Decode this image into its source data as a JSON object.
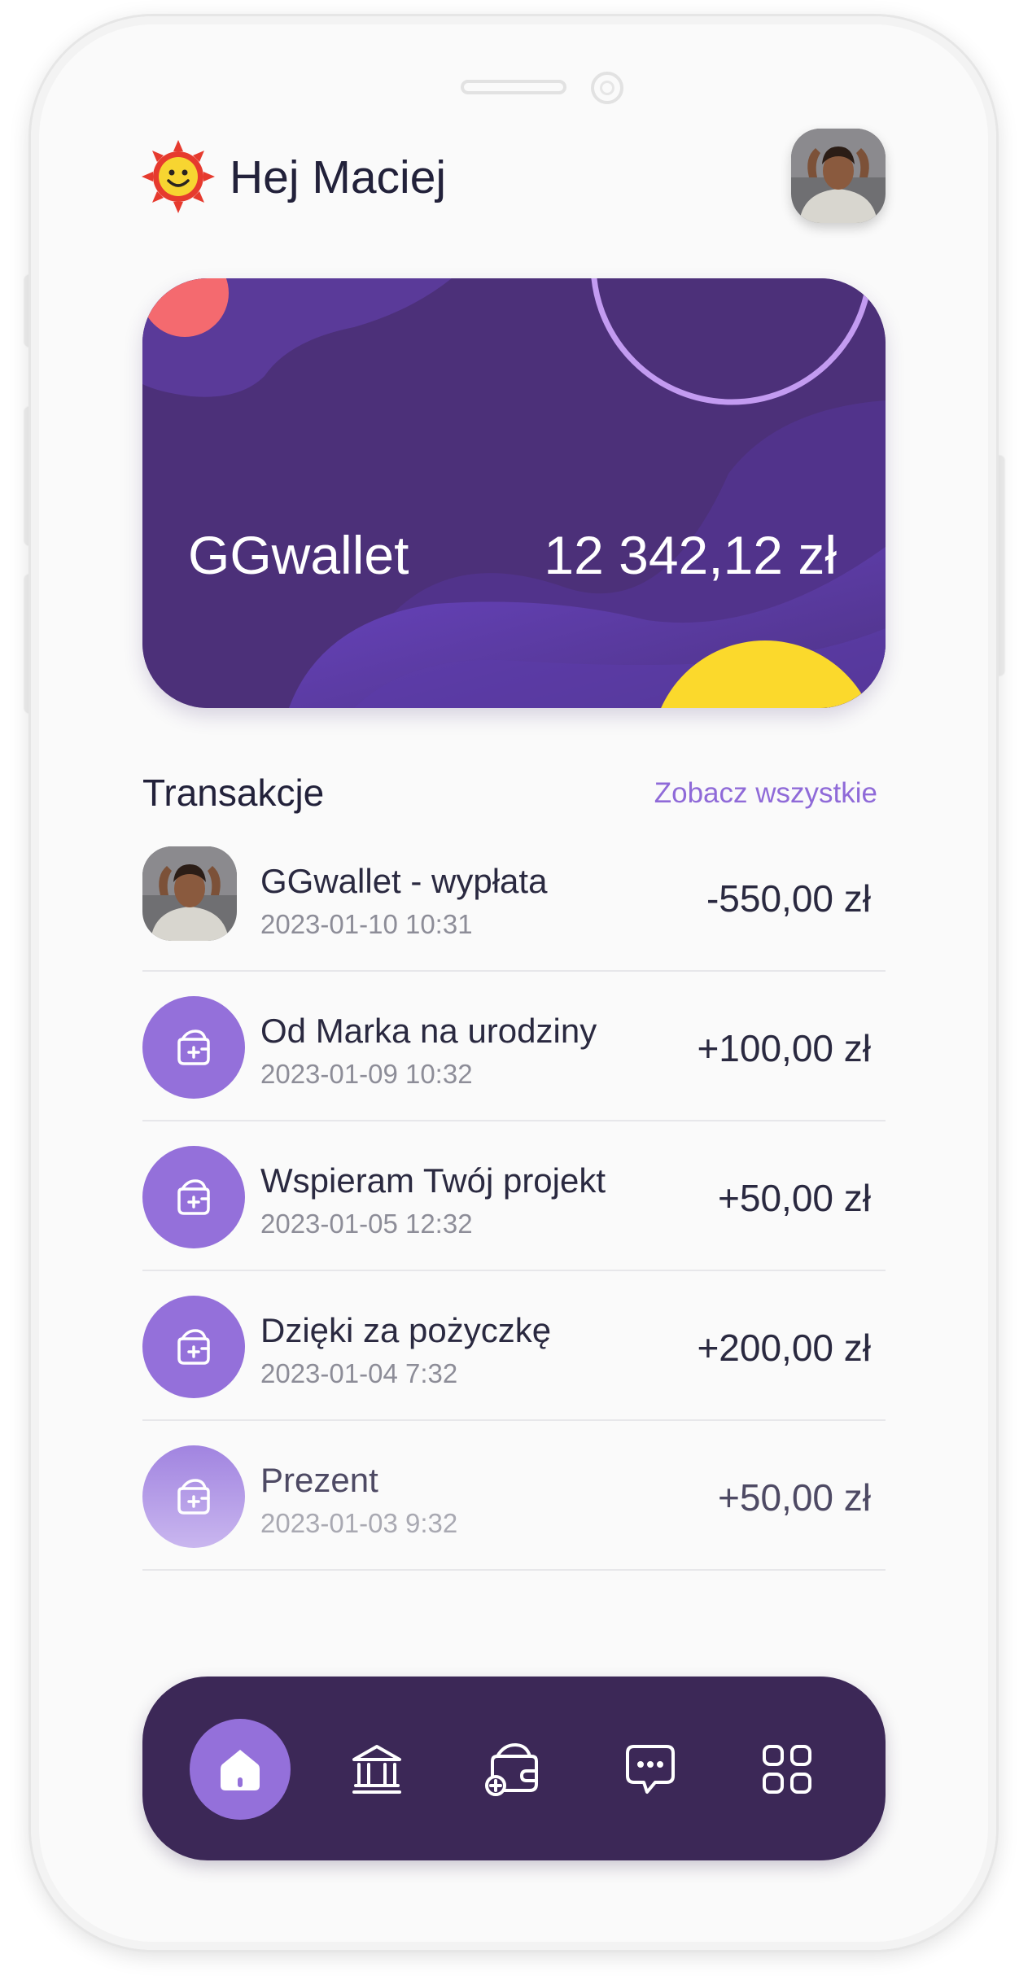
{
  "header": {
    "greeting": "Hej Maciej",
    "greeting_icon": "sun-smiley-icon",
    "avatar": "user-avatar"
  },
  "card": {
    "name": "GGwallet",
    "balance": "12 342,12 zł"
  },
  "transactions": {
    "title": "Transakcje",
    "see_all": "Zobacz wszystkie",
    "items": [
      {
        "title": "GGwallet - wypłata",
        "date": "2023-01-10 10:31",
        "amount": "-550,00 zł",
        "icon": "user-avatar"
      },
      {
        "title": "Od Marka na urodziny",
        "date": "2023-01-09 10:32",
        "amount": "+100,00 zł",
        "icon": "wallet-add-icon"
      },
      {
        "title": "Wspieram Twój projekt",
        "date": "2023-01-05 12:32",
        "amount": "+50,00 zł",
        "icon": "wallet-add-icon"
      },
      {
        "title": "Dzięki za pożyczkę",
        "date": "2023-01-04 7:32",
        "amount": "+200,00 zł",
        "icon": "wallet-add-icon"
      },
      {
        "title": "Prezent",
        "date": "2023-01-03 9:32",
        "amount": "+50,00 zł",
        "icon": "wallet-add-icon"
      }
    ]
  },
  "nav": {
    "items": [
      {
        "icon": "home-icon",
        "active": true
      },
      {
        "icon": "bank-icon",
        "active": false
      },
      {
        "icon": "wallet-icon",
        "active": false
      },
      {
        "icon": "chat-icon",
        "active": false
      },
      {
        "icon": "grid-icon",
        "active": false
      }
    ]
  },
  "colors": {
    "accent": "#9470da",
    "card": "#4b2f78",
    "nav": "#3c2857",
    "text": "#22213a",
    "link": "#8f6ad8"
  }
}
